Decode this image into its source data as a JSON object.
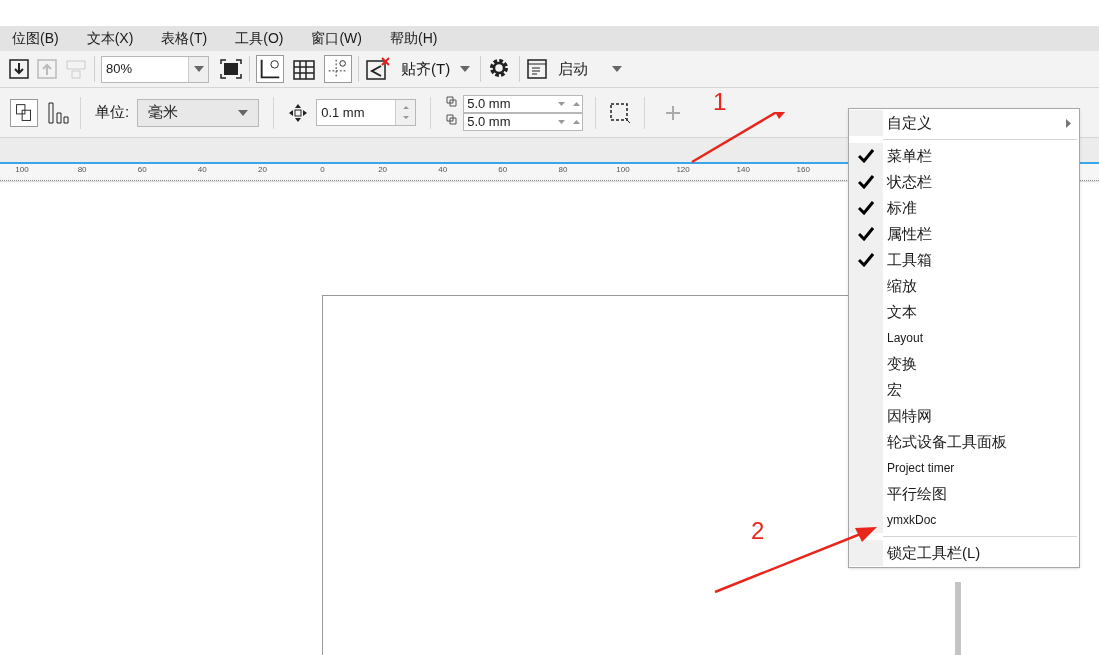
{
  "menu_bar": [
    "位图(B)",
    "文本(X)",
    "表格(T)",
    "工具(O)",
    "窗口(W)",
    "帮助(H)"
  ],
  "standard_toolbar": {
    "zoom": "80%",
    "snap": "贴齐(T)",
    "launch": "启动"
  },
  "property_bar": {
    "unit_label": "单位:",
    "unit": "毫米",
    "nudge": "0.1 mm",
    "dup_x": "5.0 mm",
    "dup_y": "5.0 mm"
  },
  "ruler": [
    "100",
    "80",
    "60",
    "40",
    "20",
    "0",
    "20",
    "40",
    "60",
    "80",
    "100",
    "120",
    "140",
    "160"
  ],
  "annotations": [
    "1",
    "2"
  ],
  "context_menu": [
    {
      "kind": "submenu",
      "label": "自定义",
      "checked": false
    },
    {
      "kind": "toggle",
      "label": "菜单栏",
      "checked": true
    },
    {
      "kind": "toggle",
      "label": "状态栏",
      "checked": true
    },
    {
      "kind": "toggle",
      "label": "标准",
      "checked": true
    },
    {
      "kind": "toggle",
      "label": "属性栏",
      "checked": true
    },
    {
      "kind": "toggle",
      "label": "工具箱",
      "checked": true
    },
    {
      "kind": "toggle",
      "label": "缩放",
      "checked": false
    },
    {
      "kind": "toggle",
      "label": "文本",
      "checked": false
    },
    {
      "kind": "toggle",
      "label": "Layout",
      "checked": false
    },
    {
      "kind": "toggle",
      "label": "变换",
      "checked": false
    },
    {
      "kind": "toggle",
      "label": "宏",
      "checked": false
    },
    {
      "kind": "toggle",
      "label": "因特网",
      "checked": false
    },
    {
      "kind": "toggle",
      "label": "轮式设备工具面板",
      "checked": false
    },
    {
      "kind": "toggle",
      "label": "Project timer",
      "checked": false
    },
    {
      "kind": "toggle",
      "label": "平行绘图",
      "checked": false
    },
    {
      "kind": "toggle",
      "label": "ymxkDoc",
      "checked": false
    },
    {
      "kind": "action",
      "label": "锁定工具栏(L)",
      "checked": false
    }
  ]
}
